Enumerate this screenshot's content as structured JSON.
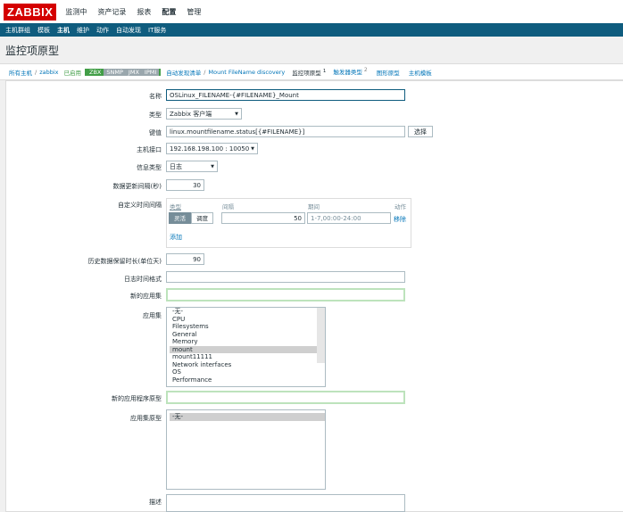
{
  "topbar": {
    "logo": "ZABBIX",
    "menu": [
      "监测中",
      "资产记录",
      "报表",
      "配置",
      "管理"
    ]
  },
  "subbar": [
    "主机群组",
    "模板",
    "主机",
    "维护",
    "动作",
    "自动发现",
    "IT服务"
  ],
  "page_title": "监控项原型",
  "nav": {
    "all_hosts": "所有主机",
    "host": "zabbix",
    "enabled": "已启用",
    "badges": [
      "ZBX",
      "SNMP",
      "JMX",
      "IPMI"
    ],
    "discovery_list": "自动发现清单",
    "discovery_rule": "Mount FileName discovery",
    "tabs": [
      {
        "label": "监控项原型",
        "count": "1"
      },
      {
        "label": "触发器类型",
        "count": "2"
      },
      {
        "label": "图形原型",
        "count": ""
      },
      {
        "label": "主机模板",
        "count": ""
      }
    ]
  },
  "form": {
    "name_label": "名称",
    "name_value": "OSLinux_FILENAME-{#FILENAME}_Mount",
    "type_label": "类型",
    "type_value": "Zabbix 客户端",
    "key_label": "键值",
    "key_value": "linux.mountfilename.status[{#FILENAME}]",
    "key_button": "选择",
    "iface_label": "主机接口",
    "iface_value": "192.168.198.100 : 10050",
    "info_label": "信息类型",
    "info_value": "日志",
    "interval_label": "数据更新间隔(秒)",
    "interval_value": "30",
    "custom_label": "自定义时间间隔",
    "custom_headers": [
      "类型",
      "间隔",
      "期间",
      "动作"
    ],
    "custom_seg": [
      "灵活",
      "调度"
    ],
    "custom_interval": "50",
    "custom_period": "1-7,00:00-24:00",
    "custom_remove": "移除",
    "custom_add": "添加",
    "history_label": "历史数据保留时长(单位天)",
    "history_value": "90",
    "logtime_label": "日志时间格式",
    "newapp_label": "新的应用集",
    "apps_label": "应用集",
    "apps": [
      "-无-",
      "CPU",
      "Filesystems",
      "General",
      "Memory",
      "mount",
      "mount11111",
      "Network interfaces",
      "OS",
      "Performance"
    ],
    "apps_selected": "mount",
    "newproto_label": "新的应用程序原型",
    "protos_label": "应用集原型",
    "protos": [
      "-无-"
    ],
    "desc_label": "描述"
  }
}
